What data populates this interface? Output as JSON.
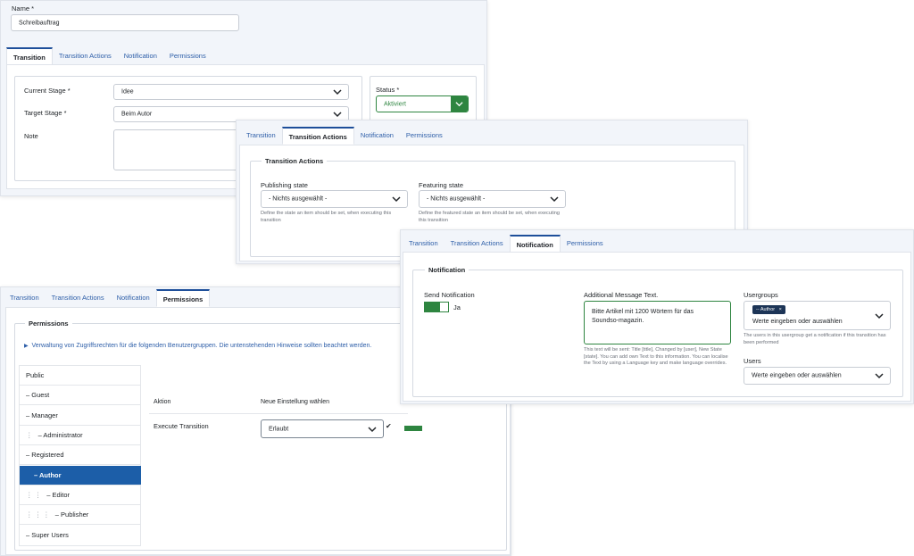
{
  "panel1": {
    "name_label": "Name *",
    "name_value": "Schreibauftrag",
    "tabs": [
      "Transition",
      "Transition Actions",
      "Notification",
      "Permissions"
    ],
    "current_stage_label": "Current Stage *",
    "current_stage_value": "Idee",
    "target_stage_label": "Target Stage *",
    "target_stage_value": "Beim Autor",
    "note_label": "Note",
    "status_label": "Status *",
    "status_value": "Aktiviert"
  },
  "panel2": {
    "tabs": [
      "Transition",
      "Transition Actions",
      "Notification",
      "Permissions"
    ],
    "legend": "Transition Actions",
    "publishing_label": "Publishing state",
    "publishing_value": "- Nichts ausgewählt -",
    "publishing_help": "Define the state an item should be set, when executing this transition",
    "featuring_label": "Featuring state",
    "featuring_value": "- Nichts ausgewählt -",
    "featuring_help": "Define the featured state an item should be set, when executing this transition"
  },
  "panel3": {
    "tabs": [
      "Transition",
      "Transition Actions",
      "Notification",
      "Permissions"
    ],
    "legend": "Notification",
    "send_label": "Send Notification",
    "send_value": "Ja",
    "message_label": "Additional Message Text.",
    "message_value": "Bitte Artikel mit 1200 Wörtern für das Soundso-magazin.",
    "message_help": "This text will be sent: Title [title], Changed by [user], New State [state]. You can add own Text to this information. You can localise the Text by using a Language key and make language overrides.",
    "usergroups_label": "Usergroups",
    "usergroups_chip": "-- Author",
    "usergroups_chip_close": "×",
    "usergroups_placeholder": "Werte eingeben oder auswählen",
    "usergroups_help": "The users in this usergroup get a notification if this transition has been performed",
    "users_label": "Users",
    "users_placeholder": "Werte eingeben oder auswählen"
  },
  "panel4": {
    "tabs": [
      "Transition",
      "Transition Actions",
      "Notification",
      "Permissions"
    ],
    "legend": "Permissions",
    "info_text": "Verwaltung von Zugriffsrechten für die folgenden Benutzergruppen. Die untenstehenden Hinweise sollten beachtet werden.",
    "groups": [
      {
        "label": "Public"
      },
      {
        "label": "– Guest"
      },
      {
        "label": "– Manager"
      },
      {
        "label": "– Administrator",
        "dots": "⋮"
      },
      {
        "label": "– Registered"
      },
      {
        "label": "– Author"
      },
      {
        "label": "– Editor",
        "dots": "⋮ ⋮"
      },
      {
        "label": "– Publisher",
        "dots": "⋮ ⋮ ⋮"
      },
      {
        "label": "– Super Users"
      }
    ],
    "col_action": "Aktion",
    "col_setting": "Neue Einstellung wählen",
    "row_action": "Execute Transition",
    "row_value": "Erlaubt",
    "row_check": "✔"
  },
  "colors": {
    "accent": "#1e4f9a",
    "link": "#2d5ea8",
    "success": "#2e8540",
    "selected": "#1c5ea8",
    "chip": "#1d3557"
  },
  "icons": [
    "chevron-down-icon",
    "check-icon",
    "info-caret-icon",
    "close-icon"
  ]
}
